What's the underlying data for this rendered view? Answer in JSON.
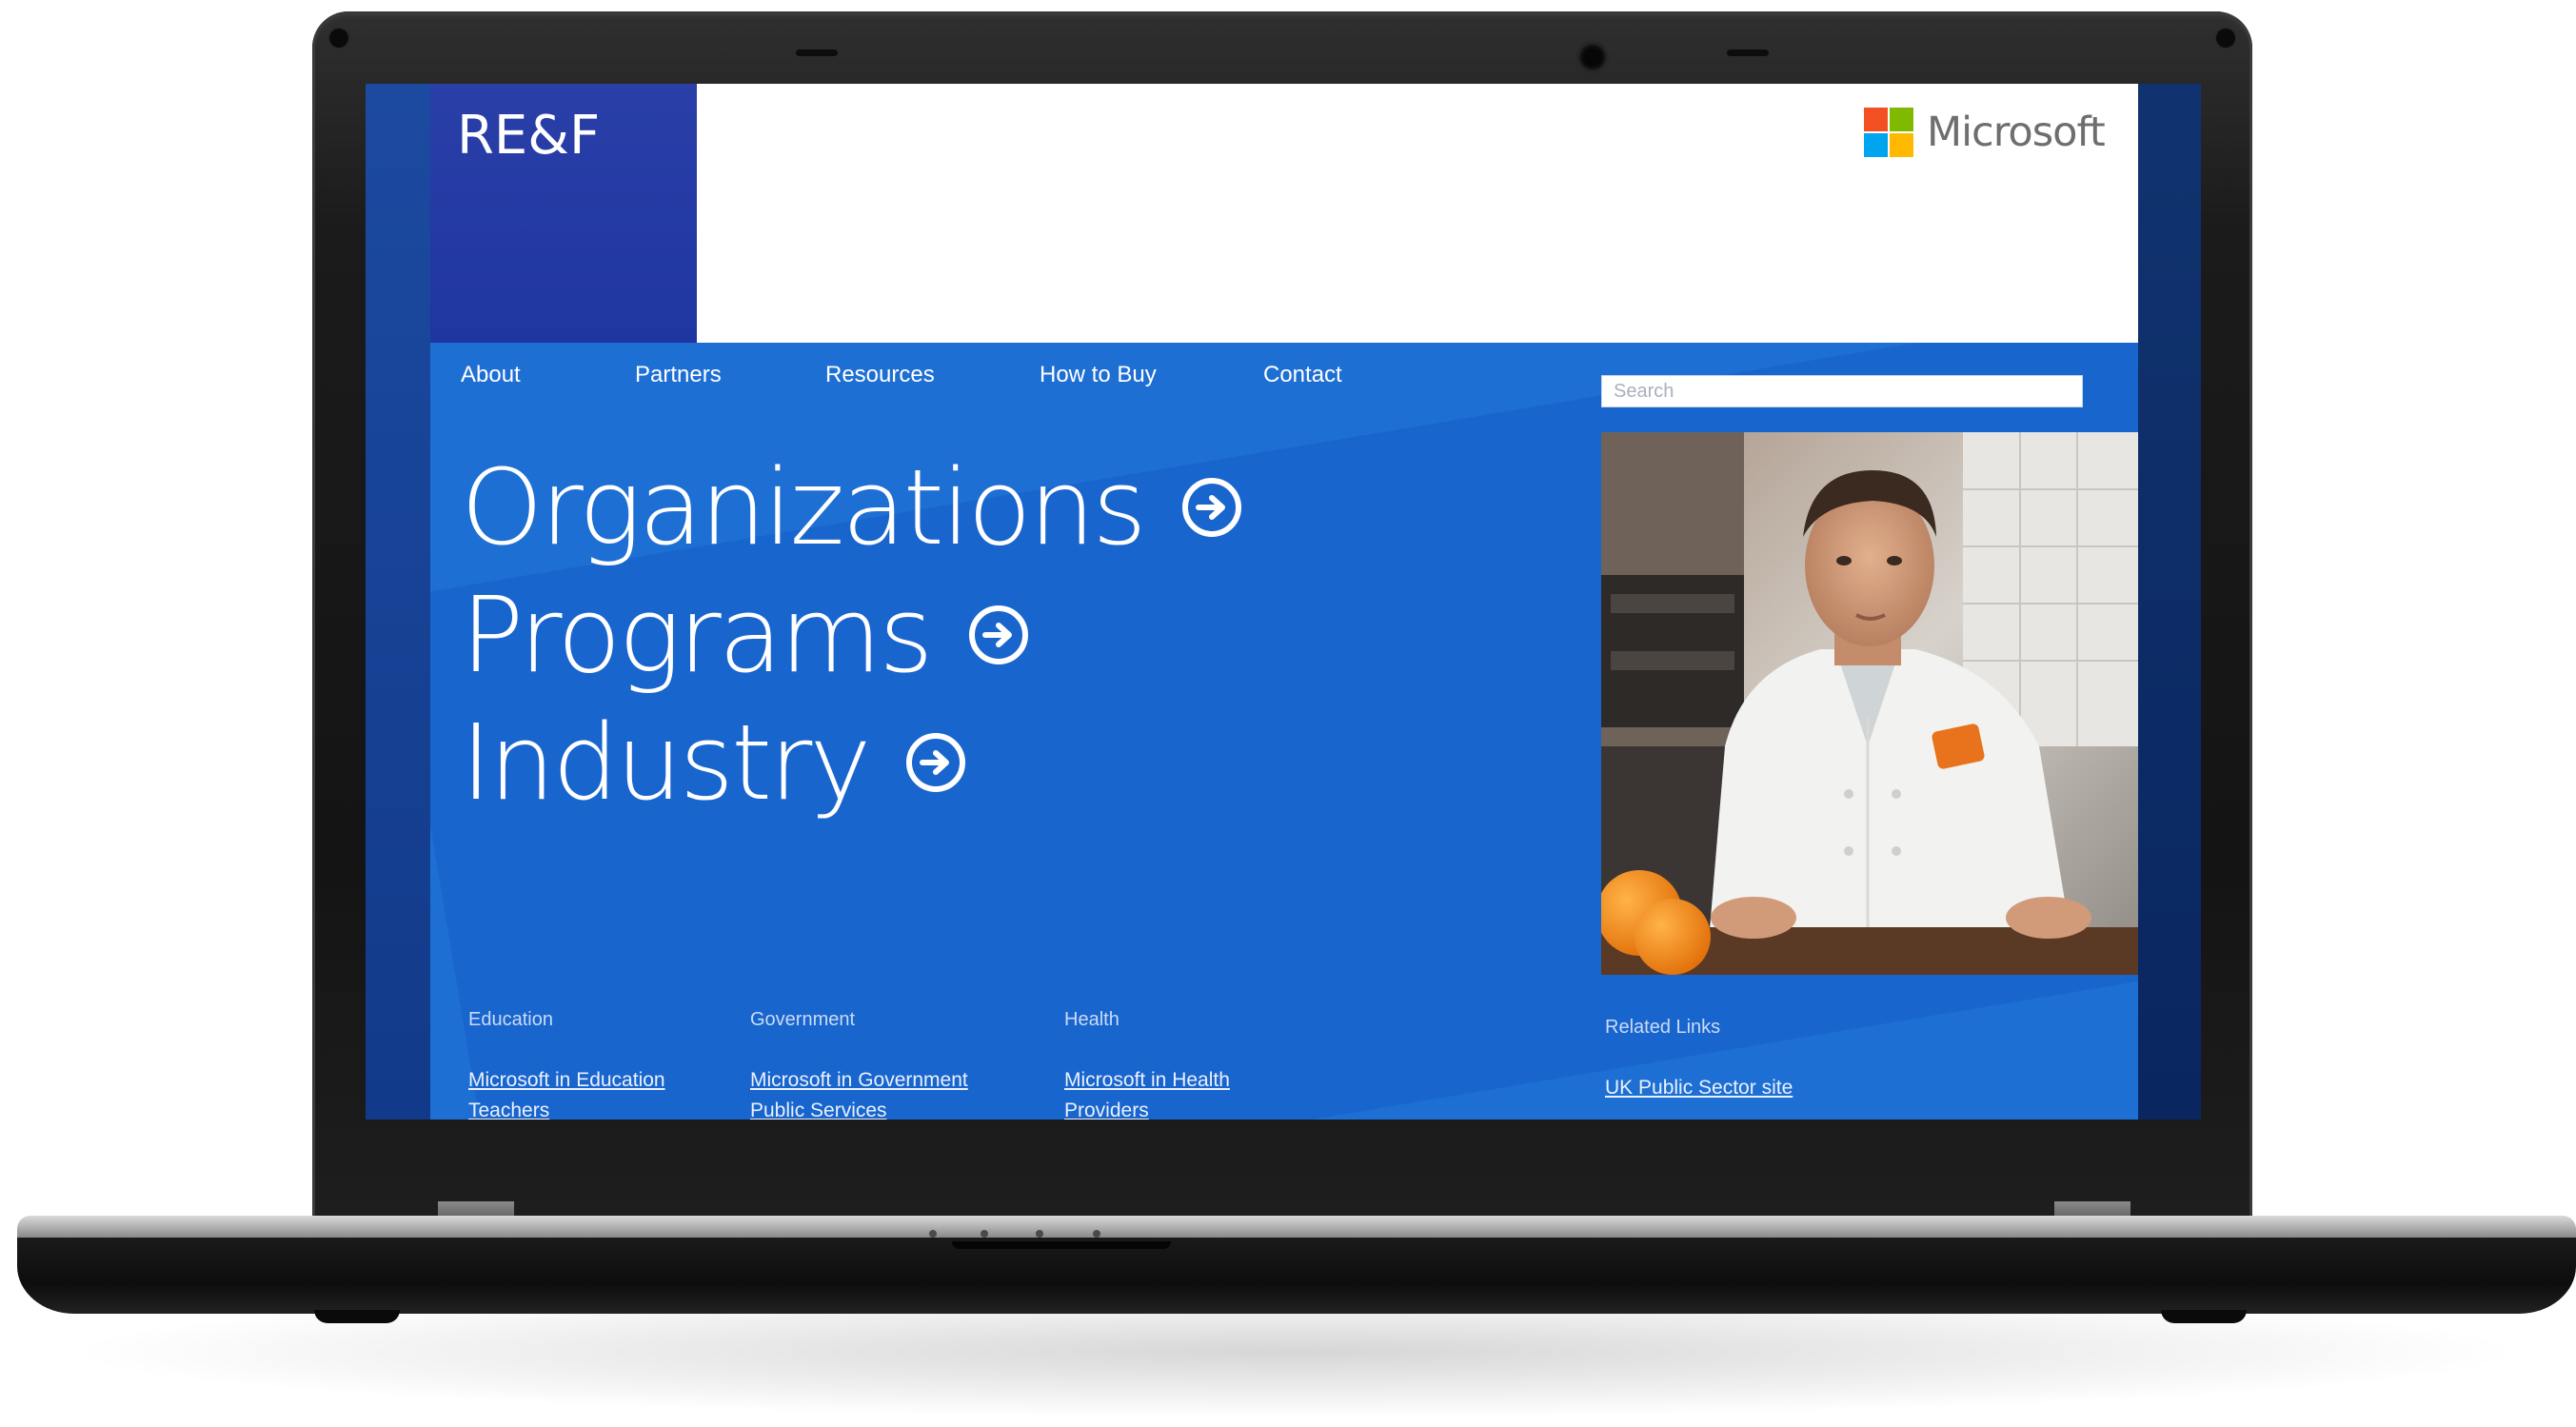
{
  "site": {
    "brand": "RE&F",
    "partner_logo_text": "Microsoft",
    "nav": [
      {
        "label": "About"
      },
      {
        "label": "Partners"
      },
      {
        "label": "Resources"
      },
      {
        "label": "How to Buy"
      },
      {
        "label": "Contact"
      }
    ],
    "search": {
      "placeholder": "Search"
    },
    "hero": [
      {
        "label": "Organizations"
      },
      {
        "label": "Programs"
      },
      {
        "label": "Industry"
      }
    ],
    "footer_columns": [
      {
        "heading": "Education",
        "links": [
          "Microsoft in Education",
          "Teachers"
        ]
      },
      {
        "heading": "Government",
        "links": [
          "Microsoft in Government",
          "Public Services"
        ]
      },
      {
        "heading": "Health",
        "links": [
          "Microsoft in Health",
          "Providers"
        ]
      },
      {
        "heading": "Related Links",
        "links": [
          "UK Public Sector site"
        ]
      }
    ]
  },
  "colors": {
    "page_blue": "#1e6fd4",
    "brand_block": "#2a3fa8",
    "ms_red": "#f25022",
    "ms_green": "#7fba00",
    "ms_blue": "#00a4ef",
    "ms_yellow": "#ffb900"
  },
  "icons": [
    "microsoft-logo-icon",
    "arrow-right-circle-icon",
    "webcam-icon"
  ]
}
